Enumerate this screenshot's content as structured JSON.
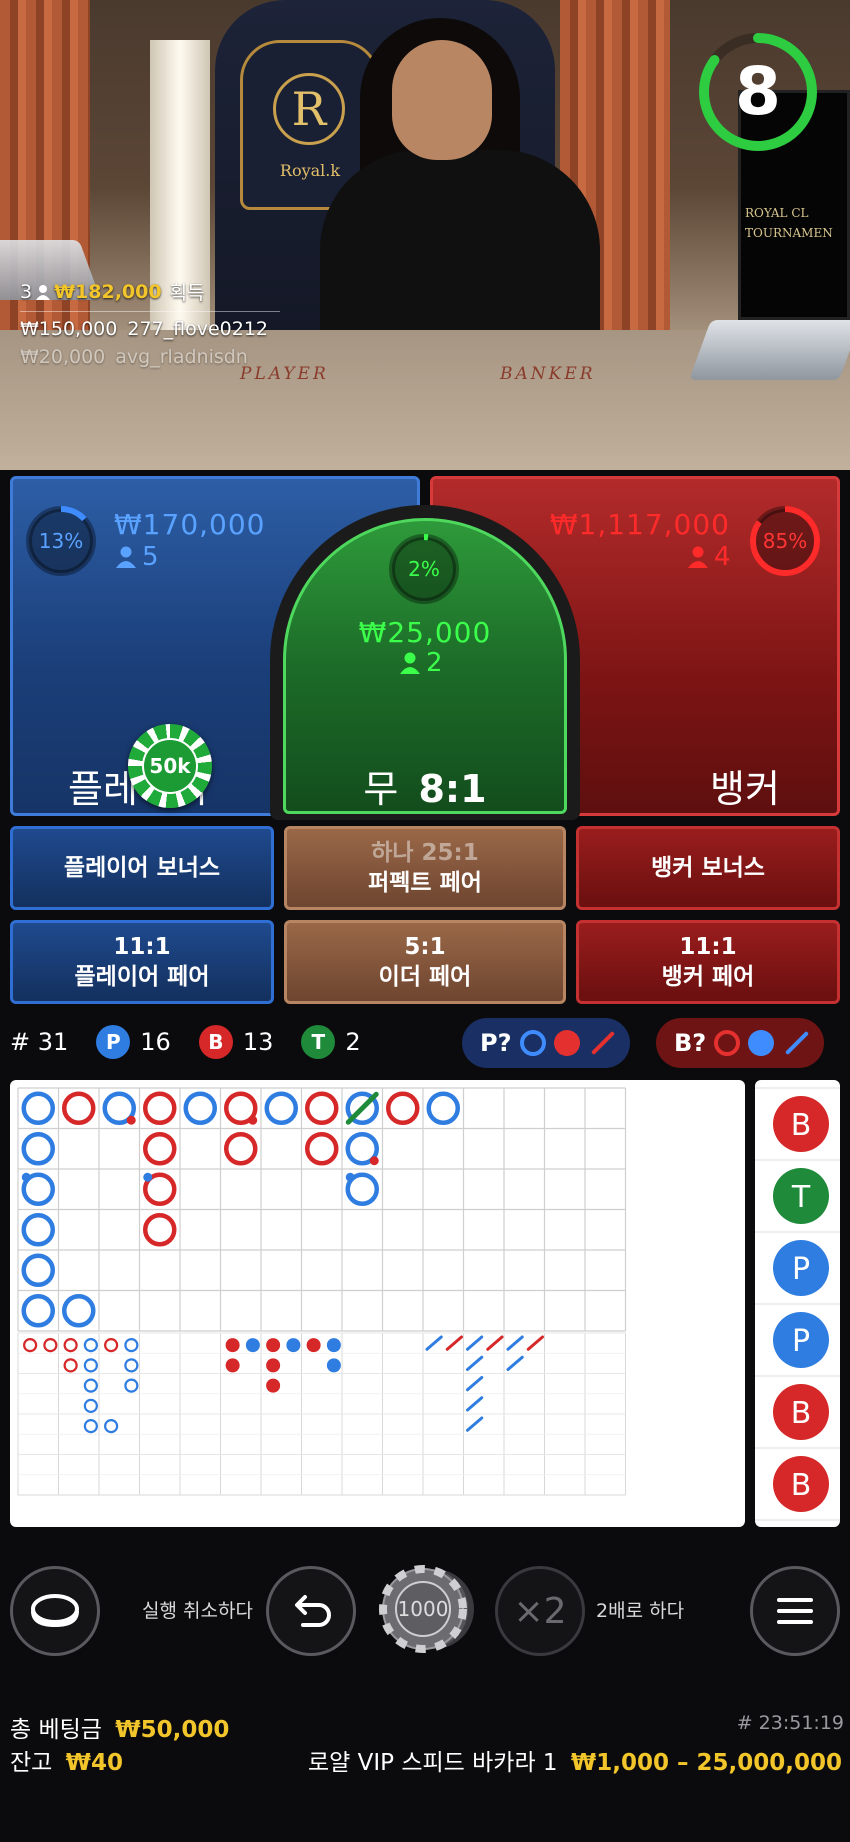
{
  "video": {
    "brand_text": "Royal.k",
    "table_labels": {
      "player": "PLAYER",
      "banker": "BANKER"
    },
    "monitor_text": [
      "ROYAL CL",
      "TOURNAMEN"
    ]
  },
  "timer": {
    "seconds": "8",
    "remaining_fraction": 0.85,
    "color": "#2ecc40"
  },
  "winners": {
    "count": "3",
    "amount": "₩182,000",
    "label": "획득",
    "entries": [
      {
        "amount": "₩150,000",
        "user": "277_flove0212"
      },
      {
        "amount": "₩20,000",
        "user": "avg_rladnisdn"
      }
    ]
  },
  "player_bet": {
    "percent": "13%",
    "percent_value": 0.13,
    "amount": "₩170,000",
    "players": "5",
    "label": "플레이어",
    "color": "#3f8cff"
  },
  "tie_bet": {
    "percent": "2%",
    "percent_value": 0.02,
    "amount": "₩25,000",
    "players": "2",
    "label": "무",
    "payout": "8:1",
    "color": "#3cff4b"
  },
  "banker_bet": {
    "percent": "85%",
    "percent_value": 0.85,
    "amount": "₩1,117,000",
    "players": "4",
    "label": "뱅커",
    "color": "#ff2a2a"
  },
  "placed_chip": {
    "value": "50k"
  },
  "side_bets": {
    "player_bonus": "플레이어 보너스",
    "perfect_pair_payout": "하나 25:1",
    "perfect_pair": "퍼펙트 페어",
    "banker_bonus": "뱅커 보너스",
    "player_pair_payout": "11:1",
    "player_pair": "플레이어 페어",
    "either_pair_payout": "5:1",
    "either_pair": "이더 페어",
    "banker_pair_payout": "11:1",
    "banker_pair": "뱅커 페어"
  },
  "stats": {
    "rounds_label": "# 31",
    "player_badge": "P",
    "player_count": "16",
    "banker_badge": "B",
    "banker_count": "13",
    "tie_badge": "T",
    "tie_count": "2",
    "player_predict": "P?",
    "banker_predict": "B?"
  },
  "big_road": [
    {
      "col": 0,
      "row": 0,
      "c": "P"
    },
    {
      "col": 0,
      "row": 1,
      "c": "P"
    },
    {
      "col": 0,
      "row": 2,
      "c": "P",
      "pair": "p"
    },
    {
      "col": 0,
      "row": 3,
      "c": "P"
    },
    {
      "col": 0,
      "row": 4,
      "c": "P"
    },
    {
      "col": 0,
      "row": 5,
      "c": "P"
    },
    {
      "col": 1,
      "row": 0,
      "c": "B"
    },
    {
      "col": 1,
      "row": 5,
      "c": "P"
    },
    {
      "col": 2,
      "row": 0,
      "c": "P",
      "pair": "b"
    },
    {
      "col": 3,
      "row": 0,
      "c": "B"
    },
    {
      "col": 3,
      "row": 1,
      "c": "B"
    },
    {
      "col": 3,
      "row": 2,
      "c": "B",
      "pair": "p"
    },
    {
      "col": 3,
      "row": 3,
      "c": "B"
    },
    {
      "col": 4,
      "row": 0,
      "c": "P"
    },
    {
      "col": 5,
      "row": 0,
      "c": "B",
      "pair": "b"
    },
    {
      "col": 5,
      "row": 1,
      "c": "B"
    },
    {
      "col": 6,
      "row": 0,
      "c": "P"
    },
    {
      "col": 7,
      "row": 0,
      "c": "B"
    },
    {
      "col": 7,
      "row": 1,
      "c": "B"
    },
    {
      "col": 8,
      "row": 0,
      "c": "P",
      "tie": true
    },
    {
      "col": 8,
      "row": 1,
      "c": "P",
      "pair": "b"
    },
    {
      "col": 8,
      "row": 2,
      "c": "P",
      "pair": "p"
    },
    {
      "col": 9,
      "row": 0,
      "c": "B"
    },
    {
      "col": 10,
      "row": 0,
      "c": "P"
    }
  ],
  "bead_road": [
    "B",
    "T",
    "P",
    "P",
    "B",
    "B"
  ],
  "controls": {
    "undo_label": "실행 취소하다",
    "chip_value": "1000",
    "double_symbol": "×2",
    "double_label": "2배로 하다"
  },
  "footer": {
    "total_bet_label": "총 베팅금",
    "total_bet": "₩50,000",
    "balance_label": "잔고",
    "balance": "₩40",
    "round_id": "# 23:51:19",
    "table_name": "로얄 VIP 스피드 바카라 1",
    "limits": "₩1,000 – 25,000,000"
  }
}
